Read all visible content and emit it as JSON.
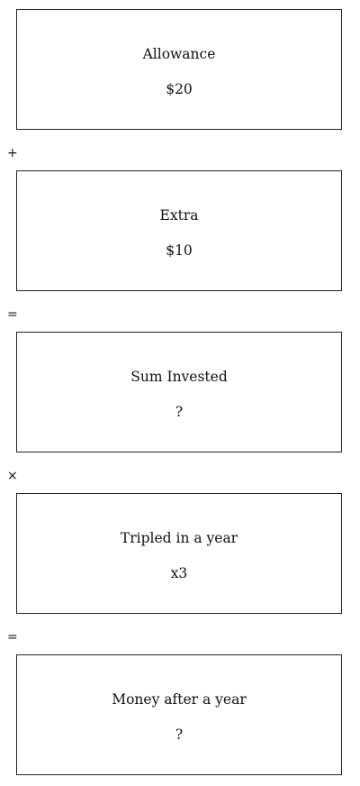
{
  "boxes": [
    {
      "label": "Allowance",
      "value": "$20"
    },
    {
      "label": "Extra",
      "value": "$10"
    },
    {
      "label": "Sum Invested",
      "value": "?"
    },
    {
      "label": "Tripled in a year",
      "value": "x3"
    },
    {
      "label": "Money after a year",
      "value": "?"
    }
  ],
  "operators": [
    "+",
    "=",
    "×",
    "="
  ]
}
